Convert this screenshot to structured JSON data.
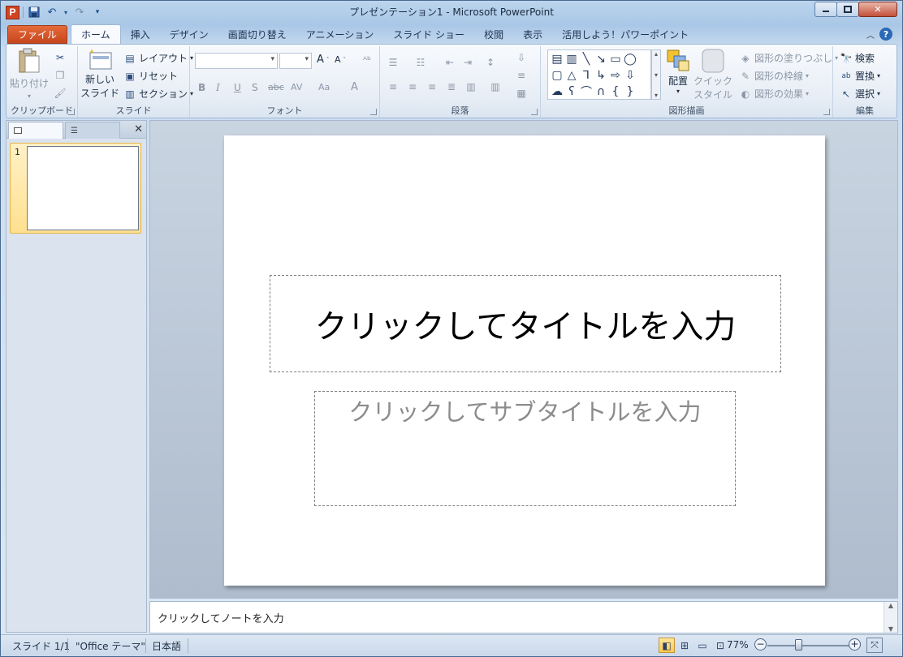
{
  "titlebar": {
    "title": "プレゼンテーション1 - Microsoft PowerPoint",
    "app_icon_letter": "P"
  },
  "tabs": [
    "ファイル",
    "ホーム",
    "挿入",
    "デザイン",
    "画面切り替え",
    "アニメーション",
    "スライド ショー",
    "校閲",
    "表示",
    "活用しよう！パワーポイント"
  ],
  "active_tab": "ホーム",
  "ribbon": {
    "clipboard": {
      "paste": "貼り付け",
      "label": "クリップボード"
    },
    "slides": {
      "new_slide_1": "新しい",
      "new_slide_2": "スライド",
      "layout": "レイアウト",
      "reset": "リセット",
      "section": "セクション",
      "label": "スライド"
    },
    "font": {
      "label": "フォント"
    },
    "paragraph": {
      "label": "段落"
    },
    "drawing": {
      "arrange": "配置",
      "quick_style_1": "クイック",
      "quick_style_2": "スタイル",
      "fill": "図形の塗りつぶし",
      "outline": "図形の枠線",
      "effects": "図形の効果",
      "label": "図形描画"
    },
    "editing": {
      "find": "検索",
      "replace": "置換",
      "select": "選択",
      "label": "編集"
    }
  },
  "left_panel": {
    "slide_number": "1"
  },
  "slide": {
    "title_placeholder": "クリックしてタイトルを入力",
    "subtitle_placeholder": "クリックしてサブタイトルを入力"
  },
  "notes": {
    "placeholder": "クリックしてノートを入力"
  },
  "statusbar": {
    "slide_info": "スライド 1/1",
    "theme": "\"Office テーマ\"",
    "language": "日本語",
    "zoom": "77%"
  }
}
